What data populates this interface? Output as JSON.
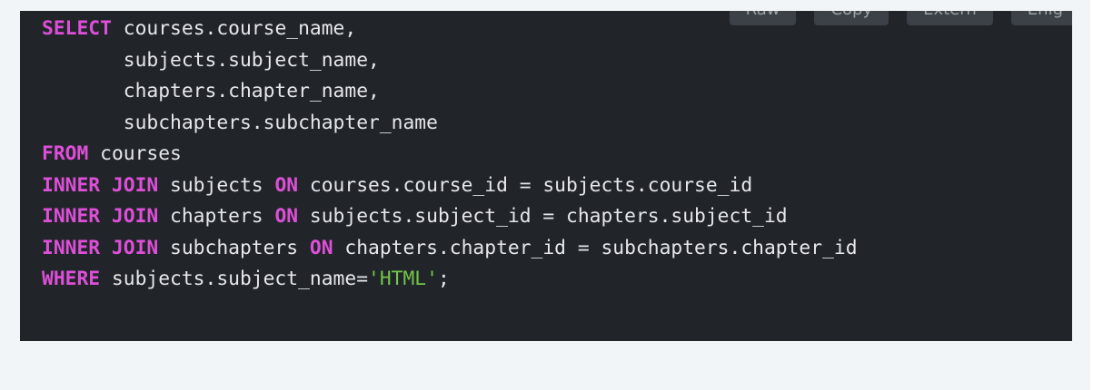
{
  "toolbar": {
    "buttons": [
      "Raw",
      "Copy",
      "Extern",
      "Enlg"
    ]
  },
  "code": {
    "language": "sql",
    "lines": [
      [
        {
          "t": "kw",
          "v": "SELECT"
        },
        {
          "t": "plain",
          "v": " courses.course_name,"
        }
      ],
      [
        {
          "t": "plain",
          "v": "       subjects.subject_name,"
        }
      ],
      [
        {
          "t": "plain",
          "v": "       chapters.chapter_name,"
        }
      ],
      [
        {
          "t": "plain",
          "v": "       subchapters.subchapter_name"
        }
      ],
      [
        {
          "t": "kw",
          "v": "FROM"
        },
        {
          "t": "plain",
          "v": " courses"
        }
      ],
      [
        {
          "t": "kw",
          "v": "INNER JOIN"
        },
        {
          "t": "plain",
          "v": " subjects "
        },
        {
          "t": "kw",
          "v": "ON"
        },
        {
          "t": "plain",
          "v": " courses.course_id = subjects.course_id"
        }
      ],
      [
        {
          "t": "kw",
          "v": "INNER JOIN"
        },
        {
          "t": "plain",
          "v": " chapters "
        },
        {
          "t": "kw",
          "v": "ON"
        },
        {
          "t": "plain",
          "v": " subjects.subject_id = chapters.subject_id"
        }
      ],
      [
        {
          "t": "kw",
          "v": "INNER JOIN"
        },
        {
          "t": "plain",
          "v": " subchapters "
        },
        {
          "t": "kw",
          "v": "ON"
        },
        {
          "t": "plain",
          "v": " chapters.chapter_id = subchapters.chapter_id"
        }
      ],
      [
        {
          "t": "kw",
          "v": "WHERE"
        },
        {
          "t": "plain",
          "v": " subjects.subject_name="
        },
        {
          "t": "str",
          "v": "'HTML'"
        },
        {
          "t": "plain",
          "v": ";"
        }
      ]
    ]
  },
  "colors": {
    "page_background": "#f2f5f8",
    "code_background": "#212529",
    "code_text": "#e5e7eb",
    "keyword": "#dd4fd8",
    "string": "#72c64a",
    "button_background": "#3c4148",
    "button_text": "#9aa0a6"
  }
}
